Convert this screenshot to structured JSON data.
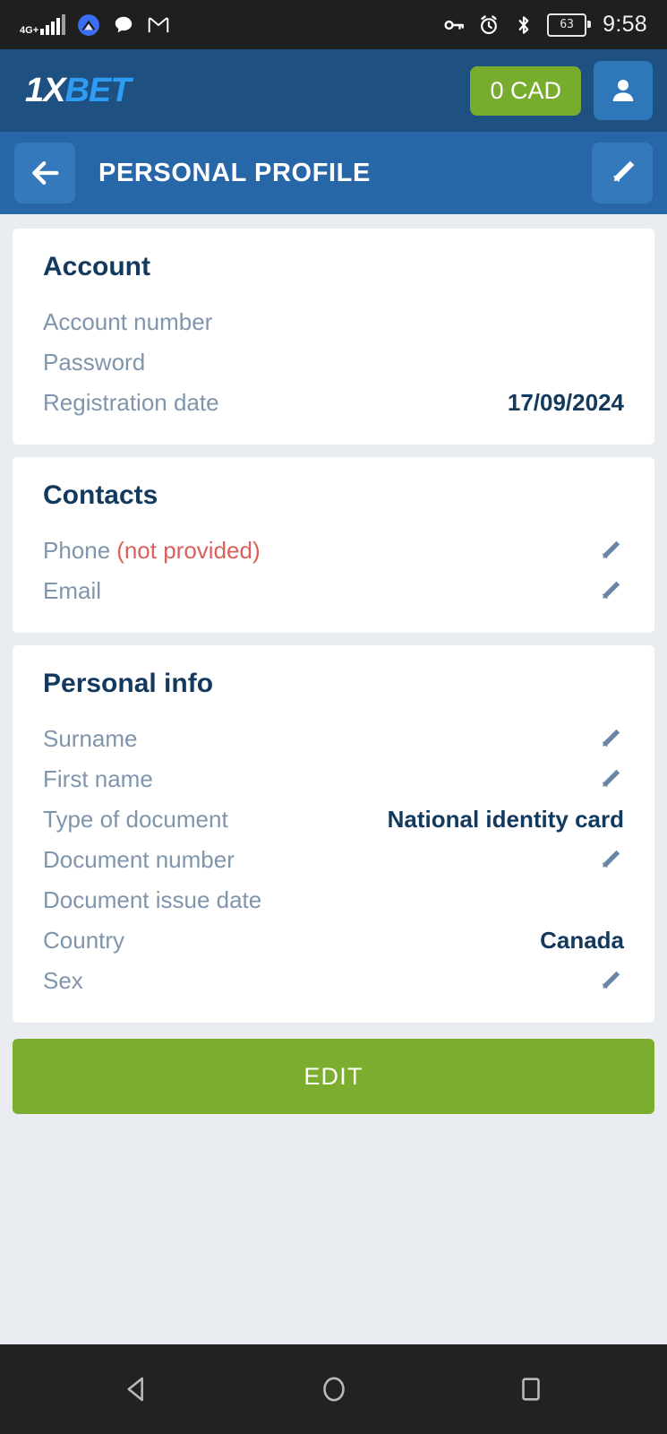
{
  "statusbar": {
    "network_label": "4G",
    "network_superscript": "+",
    "battery_level": "63",
    "clock": "9:58",
    "icons": [
      "signal-icon",
      "app-circle-icon",
      "chat-bubble-icon",
      "gmail-icon",
      "vpn-key-icon",
      "alarm-icon",
      "bluetooth-icon",
      "battery-icon"
    ]
  },
  "brandbar": {
    "logo_part1": "1X",
    "logo_part2": "BET",
    "balance": "0 CAD",
    "brand_blue": "#1f5082",
    "accent_green": "#78ac2e",
    "logo_blue": "#2f9cf4"
  },
  "titlebar": {
    "title": "PERSONAL PROFILE",
    "back_label": "Back",
    "edit_label": "Edit",
    "bar_blue": "#2767a8"
  },
  "cards": [
    {
      "heading": "Account",
      "rows": [
        {
          "label": "Account number",
          "value": "",
          "pencil": false
        },
        {
          "label": "Password",
          "value": "",
          "pencil": false
        },
        {
          "label": "Registration date",
          "value": "17/09/2024",
          "pencil": false
        }
      ]
    },
    {
      "heading": "Contacts",
      "rows": [
        {
          "label": "Phone",
          "note": "(not provided)",
          "value": "",
          "pencil": true
        },
        {
          "label": "Email",
          "value": "",
          "pencil": true
        }
      ]
    },
    {
      "heading": "Personal info",
      "rows": [
        {
          "label": "Surname",
          "value": "",
          "pencil": true
        },
        {
          "label": "First name",
          "value": "",
          "pencil": true
        },
        {
          "label": "Type of document",
          "value": "National identity card",
          "pencil": false
        },
        {
          "label": "Document number",
          "value": "",
          "pencil": true
        },
        {
          "label": "Document issue date",
          "value": "",
          "pencil": false
        },
        {
          "label": "Country",
          "value": "Canada",
          "pencil": false
        },
        {
          "label": "Sex",
          "value": "",
          "pencil": true
        }
      ]
    }
  ],
  "edit_button": {
    "label": "EDIT",
    "color": "#7cad2f"
  },
  "navbar": {
    "back": "Back",
    "home": "Home",
    "recents": "Recent apps"
  },
  "colors": {
    "page_background": "#e9edf1",
    "card_background": "#ffffff",
    "label_gray": "#8095ab",
    "value_navy": "#12395e",
    "warning_red": "#d9605c"
  }
}
